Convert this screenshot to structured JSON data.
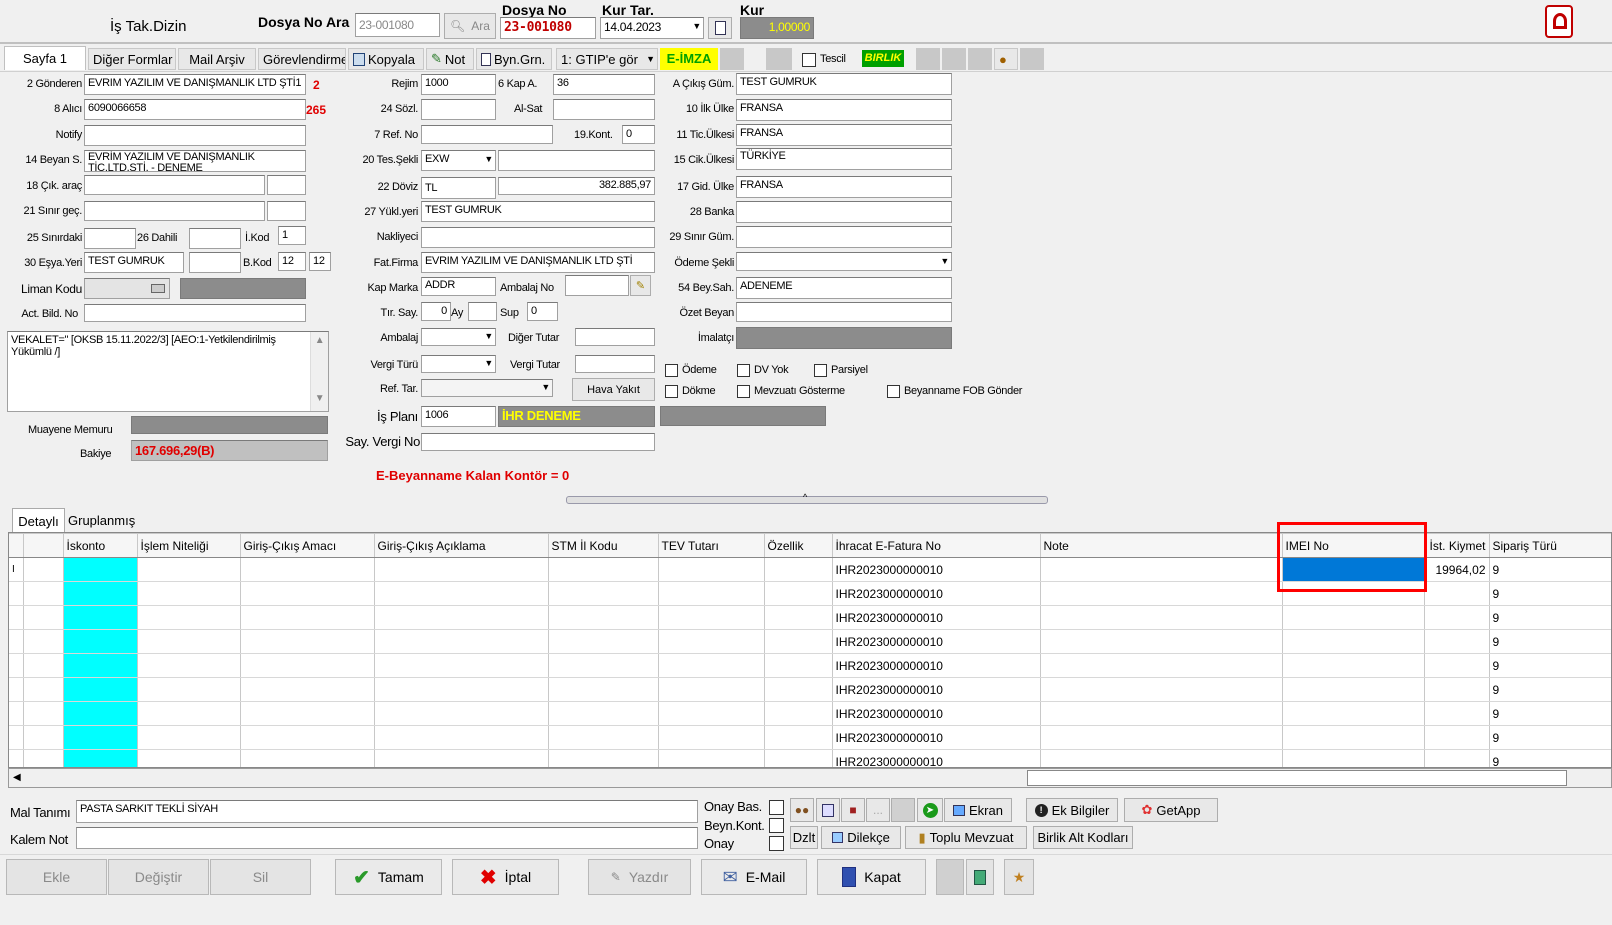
{
  "header": {
    "title": "İş Tak.Dizin",
    "dosya_ara_label": "Dosya No Ara",
    "dosya_ara_value": "23-001080",
    "ara_btn": "Ara",
    "dosya_no_label": "Dosya No",
    "dosya_no_value": "23-001080",
    "kur_tar_label": "Kur Tar.",
    "kur_tar_value": "14.04.2023",
    "kur_label": "Kur",
    "kur_value": "1,00000"
  },
  "toolbar": {
    "sayfa1": "Sayfa 1",
    "diger": "Diğer Formlar",
    "mail": "Mail Arşiv",
    "gorev": "Görevlendirme",
    "kopyala": "Kopyala",
    "not": "Not",
    "byn": "Byn.Grn.",
    "gtip": "1: GTIP'e gör",
    "eimza": "E-İMZA",
    "tescil": "Tescil",
    "birlik": "BIRLIK"
  },
  "form": {
    "gonderen_lbl": "2 Gönderen",
    "gonderen_val": "EVRIM YAZILIM VE DANIŞMANLIK LTD ŞTİ1",
    "gonderen_num": "2",
    "alici_lbl": "8 Alıcı",
    "alici_val": "6090066658",
    "alici_num": "265",
    "notify_lbl": "Notify",
    "beyan_lbl": "14 Beyan S.",
    "beyan_val": "EVRİM YAZILIM VE DANIŞMANLIK",
    "beyan_val2": "TİC.LTD.ŞTİ. - DENEME",
    "cik_lbl": "18 Çık. araç",
    "sinir_lbl": "21 Sınır geç.",
    "sinirdaki_lbl": "25 Sınırdaki",
    "dahili_lbl": "26 Dahili",
    "ikod_lbl": "İ.Kod",
    "ikod_val": "1",
    "esya_lbl": "30 Eşya.Yeri",
    "esya_val": "TEST GUMRUK",
    "bkod_lbl": "B.Kod",
    "bkod_val1": "12",
    "bkod_val2": "12",
    "liman_lbl": "Liman Kodu",
    "act_lbl": "Act. Bild. No",
    "vekalet": "VEKALET=\" [OKSB 15.11.2022/3] [AEO:1-Yetkilendirilmiş Yükümlü /]",
    "muayene_lbl": "Muayene Memuru",
    "bakiye_lbl": "Bakiye",
    "bakiye_val": "167.696,29(B)",
    "rejim_lbl": "Rejim",
    "rejim_val": "1000",
    "kap_lbl": "6 Kap A.",
    "kap_val": "36",
    "sozl_lbl": "24 Sözl.",
    "alsat_lbl": "Al-Sat",
    "ref_lbl": "7 Ref. No",
    "kont_lbl": "19.Kont.",
    "kont_val": "0",
    "tes_lbl": "20 Tes.Şekli",
    "tes_val": "EXW",
    "doviz_lbl": "22 Döviz",
    "doviz_val": "TL",
    "doviz_amt": "382.885,97",
    "yukl_lbl": "27 Yükl.yeri",
    "yukl_val": "TEST GUMRUK",
    "nakliyeci_lbl": "Nakliyeci",
    "fat_lbl": "Fat.Firma",
    "fat_val": "EVRIM YAZILIM VE DANIŞMANLIK LTD ŞTİ",
    "kapmarka_lbl": "Kap Marka",
    "kapmarka_val": "ADDR",
    "ambno_lbl": "Ambalaj No",
    "tir_lbl": "Tır. Say.",
    "tir_val": "0",
    "ay_lbl": "Ay",
    "sup_lbl": "Sup",
    "sup_val": "0",
    "ambalaj_lbl": "Ambalaj",
    "diger_tutar_lbl": "Diğer Tutar",
    "vergi_lbl": "Vergi Türü",
    "vergi_tutar_lbl": "Vergi Tutar",
    "reftar_lbl": "Ref. Tar.",
    "hava_btn": "Hava Yakıt",
    "isplani_lbl": "İş Planı",
    "isplani_val": "1006",
    "isplani_name": "İHR DENEME",
    "sayvergi_lbl": "Say. Vergi No",
    "ekontor": "E-Beyanname Kalan Kontör = 0",
    "acikis_lbl": "A Çıkış Güm.",
    "acikis_val": "TEST GUMRUK",
    "ilk_lbl": "10 İlk Ülke",
    "ilk_val": "FRANSA",
    "tic_lbl": "11 Tic.Ülkesi",
    "tic_val": "FRANSA",
    "cikulke_lbl": "15 Cik.Ülkesi",
    "cikulke_val": "TÜRKİYE",
    "gid_lbl": "17 Gid. Ülke",
    "gid_val": "FRANSA",
    "banka_lbl": "28 Banka",
    "sinirgum_lbl": "29 Sınır Güm.",
    "odeme_lbl": "Ödeme Şekli",
    "beysah_lbl": "54 Bey.Sah.",
    "beysah_val": "ADENEME",
    "ozet_lbl": "Özet Beyan",
    "imalatci_lbl": "İmalatçı",
    "c_odeme": "Ödeme",
    "c_dvyok": "DV Yok",
    "c_parsiyel": "Parsiyel",
    "c_dokme": "Dökme",
    "c_mevzuat": "Mevzuatı Gösterme",
    "c_fob": "Beyanname FOB Gönder"
  },
  "tabs": {
    "detayli": "Detaylı",
    "gruplanmis": "Gruplanmış"
  },
  "grid": {
    "headers": [
      "İskonto",
      "İşlem Niteliği",
      "Giriş-Çıkış Amacı",
      "Giriş-Çıkış Açıklama",
      "STM İl Kodu",
      "TEV Tutarı",
      "Özellik",
      "İhracat E-Fatura No",
      "Note",
      "IMEI No",
      "İst. Kiymet",
      "Sipariş Türü"
    ],
    "efatura": "IHR2023000000010",
    "kiymet_first": "19964,02",
    "siparis": "9",
    "row_marker": "I"
  },
  "bottom": {
    "mal_lbl": "Mal Tanımı",
    "mal_val": "PASTA SARKIT TEKLİ SİYAH",
    "kalem_lbl": "Kalem Not",
    "onaybas": "Onay Bas.",
    "beynkont": "Beyn.Kont.",
    "onay": "Onay",
    "ekran": "Ekran",
    "ekbilgiler": "Ek Bilgiler",
    "getapp": "GetApp",
    "dzlt": "Dzlt",
    "dilekce": "Dilekçe",
    "toplu": "Toplu Mevzuat",
    "birlikalt": "Birlik Alt Kodları"
  },
  "actions": {
    "ekle": "Ekle",
    "degistir": "Değiştir",
    "sil": "Sil",
    "tamam": "Tamam",
    "iptal": "İptal",
    "yazdir": "Yazdır",
    "email": "E-Mail",
    "kapat": "Kapat"
  }
}
